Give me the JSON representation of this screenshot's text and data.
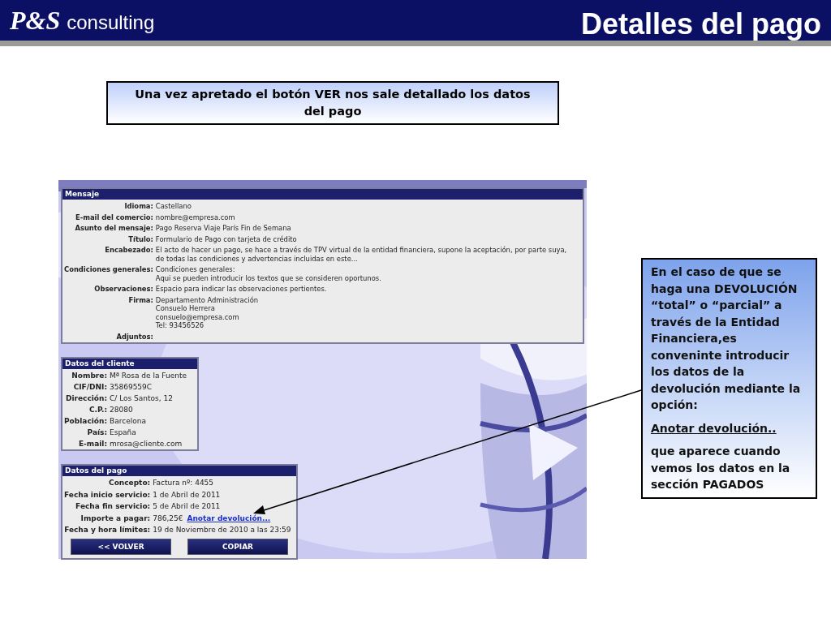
{
  "header": {
    "logo": "P&S",
    "logo_suffix": "consulting",
    "title": "Detalles del pago"
  },
  "intro": "Una vez apretado el botón VER nos sale detallado los datos del pago",
  "app": {
    "panels": [
      {
        "title": "Mensaje",
        "fields": [
          {
            "label": "Idioma:",
            "lines": [
              "Castellano"
            ]
          },
          {
            "label": "E-mail del comercio:",
            "lines": [
              "nombre@empresa.com"
            ]
          },
          {
            "label": "Asunto del mensaje:",
            "lines": [
              "Pago Reserva Viaje París Fin de Semana"
            ]
          },
          {
            "label": "Título:",
            "lines": [
              "Formulario de Pago con tarjeta de crédito"
            ]
          },
          {
            "label": "Encabezado:",
            "lines": [
              "El acto de hacer un pago, se hace a través de TPV virtual de la entidad financiera, supone la aceptación, por parte suya,",
              "de todas las condiciones y advertencias incluidas en este..."
            ]
          },
          {
            "label": "Condiciones generales:",
            "lines": [
              "Condiciones generales:",
              "Aqui se pueden introducir los textos que se consideren oportunos."
            ]
          },
          {
            "label": "Observaciones:",
            "lines": [
              "Espacio para indicar las observaciones pertientes."
            ]
          },
          {
            "label": "Firma:",
            "lines": [
              "Departamento Administración",
              "Consuelo Herrera",
              "consuelo@empresa.com",
              "Tel: 93456526"
            ]
          },
          {
            "label": "Adjuntos:"
          }
        ]
      },
      {
        "title": "Datos del cliente",
        "fields": [
          {
            "label": "Nombre:",
            "lines": [
              "Mª Rosa de la Fuente"
            ]
          },
          {
            "label": "CIF/DNI:",
            "lines": [
              "35869559C"
            ]
          },
          {
            "label": "Dirección:",
            "lines": [
              "C/ Los Santos, 12"
            ]
          },
          {
            "label": "C.P.:",
            "lines": [
              "28080"
            ]
          },
          {
            "label": "Población:",
            "lines": [
              "Barcelona"
            ]
          },
          {
            "label": "País:",
            "lines": [
              "España"
            ]
          },
          {
            "label": "E-mail:",
            "lines": [
              "mrosa@cliente.com"
            ]
          }
        ]
      },
      {
        "title": "Datos del pago",
        "fields": [
          {
            "label": "Concepto:",
            "lines": [
              "Factura nº: 4455"
            ]
          },
          {
            "label": "Fecha inicio servicio:",
            "lines": [
              "1 de Abril de 2011"
            ]
          },
          {
            "label": "Fecha fin servicio:",
            "lines": [
              "5 de Abril de 2011"
            ]
          },
          {
            "label": "Importe a pagar:",
            "lines": [
              "786,25€"
            ],
            "link": "Anotar devolución..."
          },
          {
            "label": "Fecha y hora límites:",
            "lines": [
              "19 de Noviembre de 2010 a las 23:59"
            ]
          }
        ],
        "buttons": [
          "<< VOLVER",
          "COPIAR"
        ]
      }
    ]
  },
  "note": [
    {
      "kind": "text",
      "text": "En el caso de que se haga una DEVOLUCIÓN “total” o “parcial” a través de la Entidad Financiera,es conveninte introducir los datos de la devolución mediante la opción:"
    },
    {
      "kind": "link",
      "text": "Anotar devolución.."
    },
    {
      "kind": "text",
      "text": "que aparece cuando vemos los datos en la sección PAGADOS"
    }
  ]
}
